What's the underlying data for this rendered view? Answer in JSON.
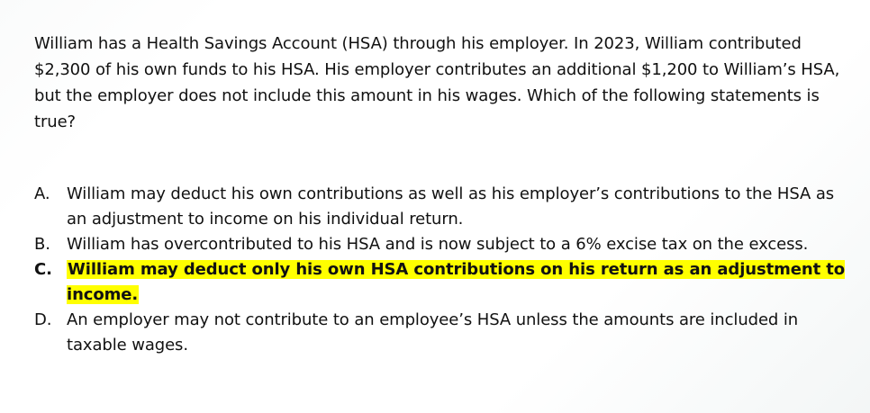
{
  "question": {
    "text": "William has a Health Savings Account (HSA) through his employer. In 2023, William contributed $2,300 of his own funds to his HSA. His employer contributes an additional $1,200 to William’s HSA, but the employer does not include this amount in his wages. Which of the following statements is true?"
  },
  "answers": [
    {
      "letter": "A.",
      "text": "William may deduct his own contributions as well as his employer’s contributions to the HSA as an adjustment to income on his individual return."
    },
    {
      "letter": "B.",
      "text": "William has overcontributed to his HSA and is now subject to a 6% excise tax on the excess."
    },
    {
      "letter": "C.",
      "text": "William may deduct only his own HSA contributions on his return as an adjustment to income."
    },
    {
      "letter": "D.",
      "text": "An employer may not contribute to an employee’s HSA unless the amounts are included in taxable wages."
    }
  ],
  "highlight_color": "#ffff00",
  "text_color": "#111111"
}
